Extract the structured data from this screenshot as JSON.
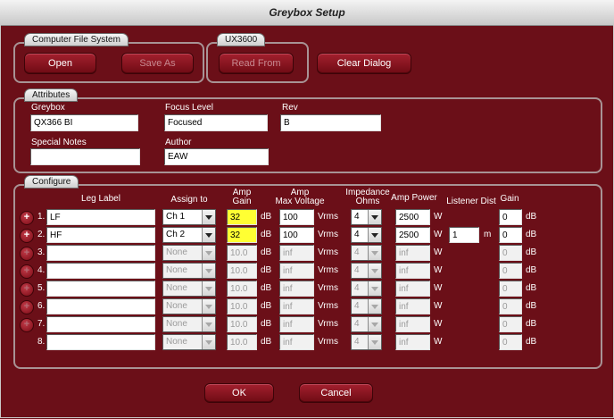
{
  "window": {
    "title": "Greybox Setup"
  },
  "groups": {
    "computer_file_system": "Computer File System",
    "ux3600": "UX3600",
    "attributes": "Attributes",
    "configure": "Configure"
  },
  "buttons": {
    "open": "Open",
    "save_as": "Save As",
    "read_from": "Read From",
    "clear_dialog": "Clear Dialog",
    "ok": "OK",
    "cancel": "Cancel"
  },
  "attributes": {
    "greybox_label": "Greybox",
    "greybox_value": "QX366 BI",
    "focus_level_label": "Focus Level",
    "focus_level_value": "Focused",
    "rev_label": "Rev",
    "rev_value": "B",
    "special_notes_label": "Special Notes",
    "special_notes_value": "",
    "author_label": "Author",
    "author_value": "EAW"
  },
  "configure": {
    "headers": {
      "leg_label": "Leg Label",
      "assign_to": "Assign to",
      "amp_gain_1": "Amp",
      "amp_gain_2": "Gain",
      "amp_max_1": "Amp",
      "amp_max_2": "Max Voltage",
      "imp_1": "Impedance",
      "imp_2": "Ohms",
      "amp_power": "Amp Power",
      "listener_dist": "Listener Dist",
      "gain": "Gain"
    },
    "units": {
      "db": "dB",
      "vrms": "Vrms",
      "w": "W",
      "m": "m"
    },
    "rows": [
      {
        "num": "1.",
        "plus": "+",
        "leg": "LF",
        "assign": "Ch 1",
        "amp_gain": "32",
        "max_v": "100",
        "imp": "4",
        "power": "2500",
        "dist": "",
        "gain": "0"
      },
      {
        "num": "2.",
        "plus": "+",
        "leg": "HF",
        "assign": "Ch 2",
        "amp_gain": "32",
        "max_v": "100",
        "imp": "4",
        "power": "2500",
        "dist": "1",
        "gain": "0"
      },
      {
        "num": "3.",
        "plus": "+",
        "leg": "",
        "assign": "None",
        "amp_gain": "10.0",
        "max_v": "inf",
        "imp": "4",
        "power": "inf",
        "dist": "",
        "gain": "0"
      },
      {
        "num": "4.",
        "plus": "+",
        "leg": "",
        "assign": "None",
        "amp_gain": "10.0",
        "max_v": "inf",
        "imp": "4",
        "power": "inf",
        "dist": "",
        "gain": "0"
      },
      {
        "num": "5.",
        "plus": "+",
        "leg": "",
        "assign": "None",
        "amp_gain": "10.0",
        "max_v": "inf",
        "imp": "4",
        "power": "inf",
        "dist": "",
        "gain": "0"
      },
      {
        "num": "6.",
        "plus": "+",
        "leg": "",
        "assign": "None",
        "amp_gain": "10.0",
        "max_v": "inf",
        "imp": "4",
        "power": "inf",
        "dist": "",
        "gain": "0"
      },
      {
        "num": "7.",
        "plus": "+",
        "leg": "",
        "assign": "None",
        "amp_gain": "10.0",
        "max_v": "inf",
        "imp": "4",
        "power": "inf",
        "dist": "",
        "gain": "0"
      },
      {
        "num": "8.",
        "plus": "",
        "leg": "",
        "assign": "None",
        "amp_gain": "10.0",
        "max_v": "inf",
        "imp": "4",
        "power": "inf",
        "dist": "",
        "gain": "0"
      }
    ]
  },
  "colors": {
    "background": "#6b0f18",
    "highlight": "#ffff33",
    "button": "#8a1520"
  }
}
